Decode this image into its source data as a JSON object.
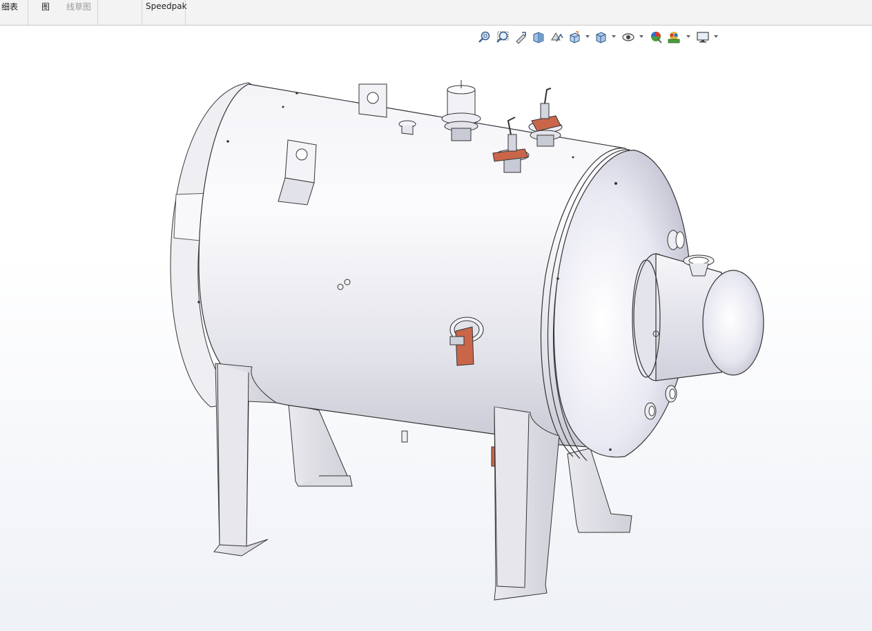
{
  "ribbon": {
    "groups": [
      {
        "label": "细表"
      },
      {
        "label": "图"
      },
      {
        "label": "线草图"
      },
      {
        "label": "Speedpak"
      }
    ]
  },
  "heads_up_toolbar": {
    "icons": [
      "zoom-to-fit-icon",
      "zoom-to-area-icon",
      "previous-view-icon",
      "section-view-icon",
      "dynamic-annotation-views-icon",
      "view-orientation-icon",
      "display-style-icon",
      "hide-show-items-icon",
      "edit-appearance-icon",
      "apply-scene-icon",
      "view-settings-icon"
    ]
  },
  "model": {
    "name": "horizontal-pressure-vessel"
  }
}
